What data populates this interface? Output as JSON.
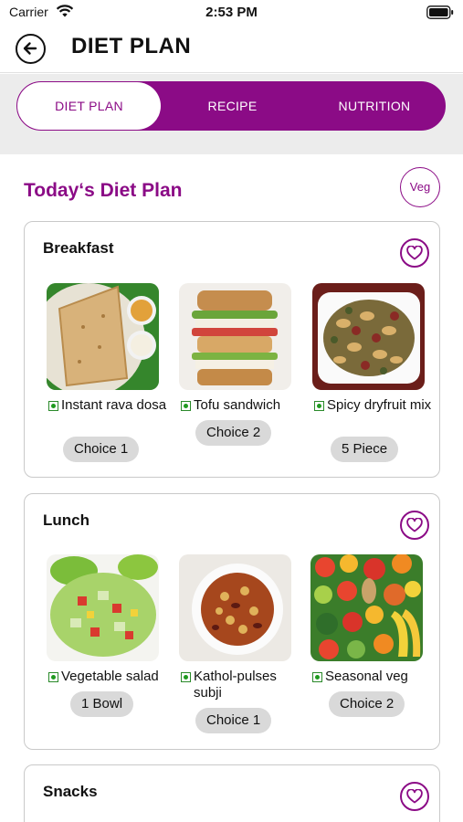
{
  "status_bar": {
    "carrier": "Carrier",
    "time": "2:53 PM"
  },
  "header": {
    "title": "DIET PLAN",
    "back_icon": "arrow-left-circle-icon"
  },
  "tabs": [
    {
      "label": "DIET PLAN",
      "active": true
    },
    {
      "label": "RECIPE",
      "active": false
    },
    {
      "label": "NUTRITION",
      "active": false
    }
  ],
  "section": {
    "title": "Today‘s Diet Plan",
    "filter_label": "Veg"
  },
  "colors": {
    "accent": "#8b0b86",
    "veg_green": "#1f9a1f",
    "pill_bg": "#d9d9d9"
  },
  "meals": [
    {
      "title": "Breakfast",
      "fav_icon": "heart-icon",
      "items": [
        {
          "name": "Instant rava dosa",
          "qty": "Choice 1",
          "image": "rava-dosa-photo"
        },
        {
          "name": "Tofu sandwich",
          "qty": "Choice 2",
          "image": "tofu-sandwich-photo"
        },
        {
          "name": "Spicy dryfruit mix",
          "qty": "5 Piece",
          "image": "dryfruit-mix-photo"
        }
      ]
    },
    {
      "title": "Lunch",
      "fav_icon": "heart-icon",
      "items": [
        {
          "name": "Vegetable salad",
          "qty": "1 Bowl",
          "image": "vegetable-salad-photo"
        },
        {
          "name": "Kathol-pulses subji",
          "qty": "Choice 1",
          "image": "kathol-subji-photo"
        },
        {
          "name": "Seasonal veg",
          "qty": "Choice 2",
          "image": "seasonal-veg-photo"
        }
      ]
    },
    {
      "title": "Snacks",
      "fav_icon": "heart-icon",
      "items": []
    }
  ]
}
